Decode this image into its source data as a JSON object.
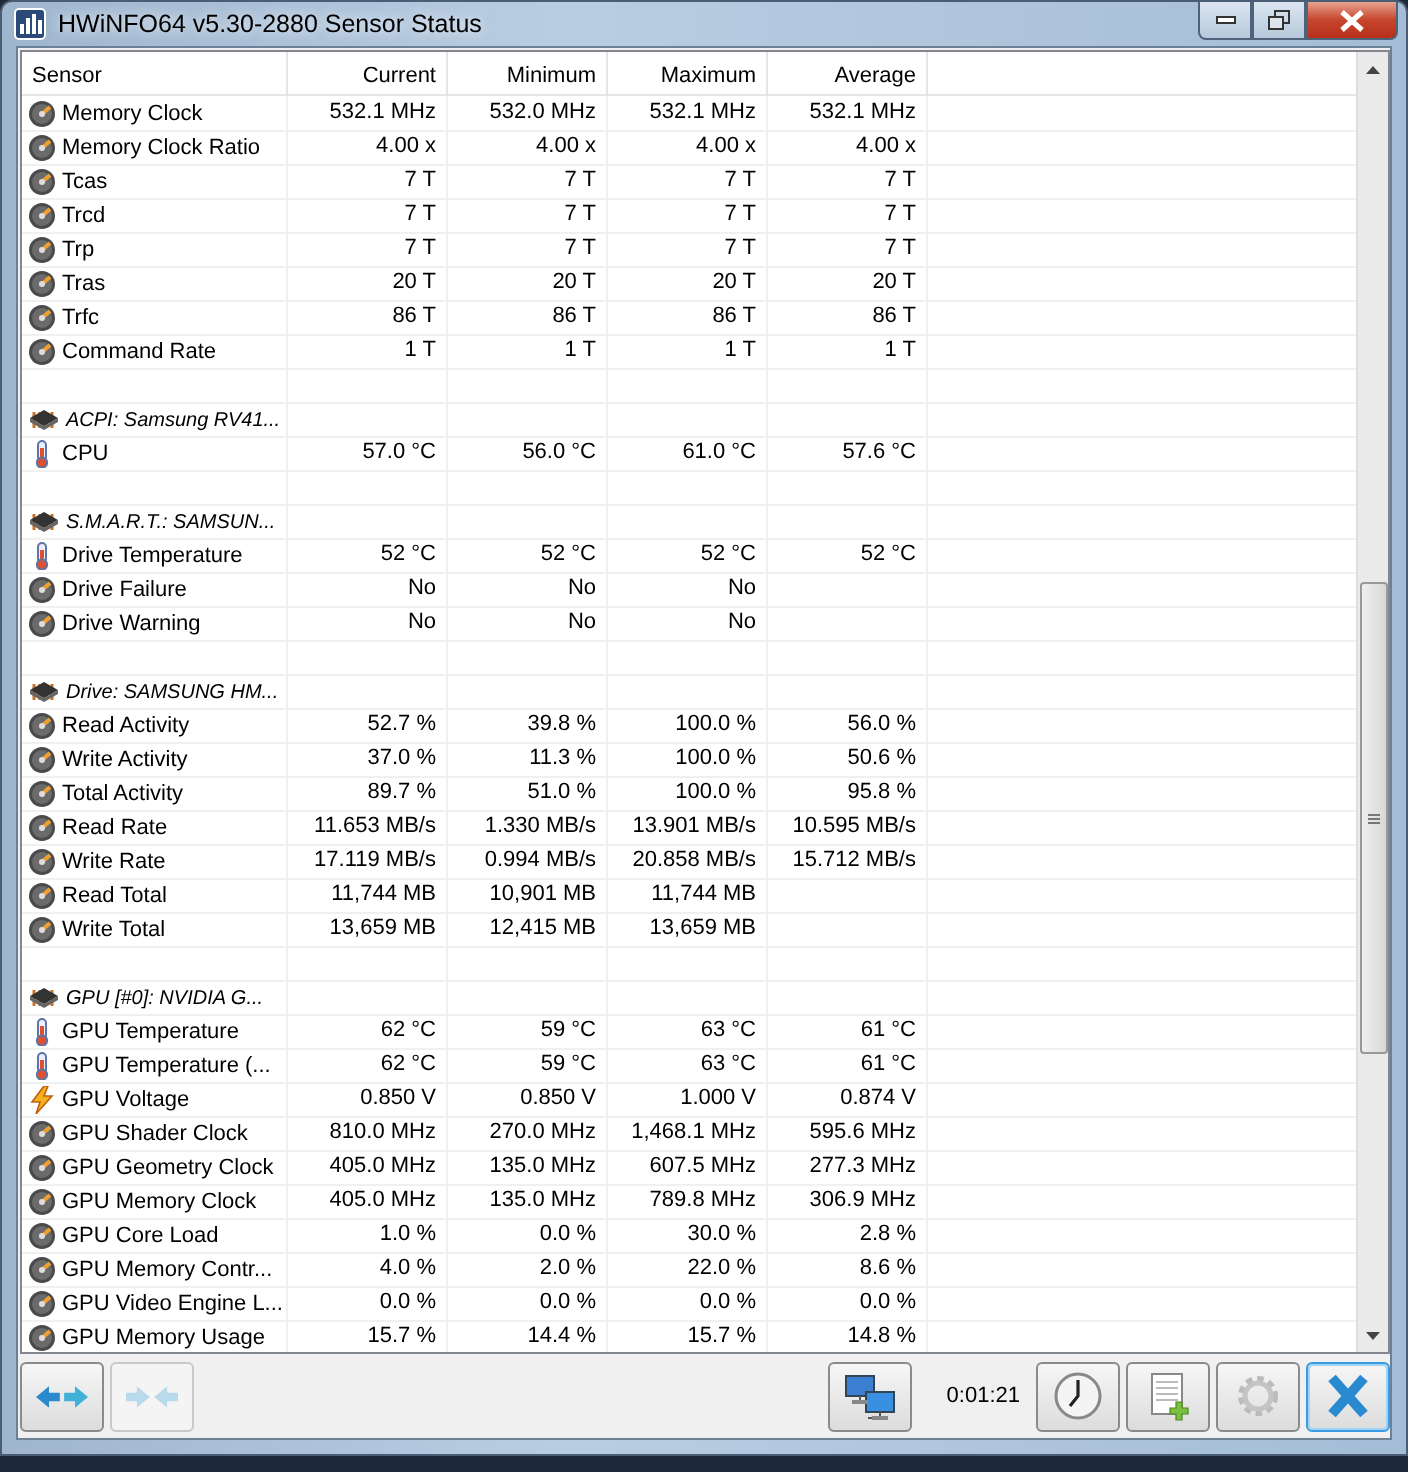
{
  "window": {
    "title": "HWiNFO64 v5.30-2880 Sensor Status"
  },
  "table": {
    "columns": [
      "Sensor",
      "Current",
      "Minimum",
      "Maximum",
      "Average"
    ],
    "rows": [
      {
        "kind": "other",
        "cells": [
          "Memory Clock",
          "532.1 MHz",
          "532.0 MHz",
          "532.1 MHz",
          "532.1 MHz"
        ]
      },
      {
        "kind": "other",
        "cells": [
          "Memory Clock Ratio",
          "4.00 x",
          "4.00 x",
          "4.00 x",
          "4.00 x"
        ]
      },
      {
        "kind": "other",
        "cells": [
          "Tcas",
          "7 T",
          "7 T",
          "7 T",
          "7 T"
        ]
      },
      {
        "kind": "other",
        "cells": [
          "Trcd",
          "7 T",
          "7 T",
          "7 T",
          "7 T"
        ]
      },
      {
        "kind": "other",
        "cells": [
          "Trp",
          "7 T",
          "7 T",
          "7 T",
          "7 T"
        ]
      },
      {
        "kind": "other",
        "cells": [
          "Tras",
          "20 T",
          "20 T",
          "20 T",
          "20 T"
        ]
      },
      {
        "kind": "other",
        "cells": [
          "Trfc",
          "86 T",
          "86 T",
          "86 T",
          "86 T"
        ]
      },
      {
        "kind": "other",
        "cells": [
          "Command Rate",
          "1 T",
          "1 T",
          "1 T",
          "1 T"
        ]
      },
      {
        "kind": "blank"
      },
      {
        "kind": "group",
        "label": "ACPI: Samsung RV41..."
      },
      {
        "kind": "temperature",
        "cells": [
          "CPU",
          "57.0 °C",
          "56.0 °C",
          "61.0 °C",
          "57.6 °C"
        ]
      },
      {
        "kind": "blank"
      },
      {
        "kind": "group",
        "label": "S.M.A.R.T.: SAMSUN..."
      },
      {
        "kind": "temperature",
        "cells": [
          "Drive Temperature",
          "52 °C",
          "52 °C",
          "52 °C",
          "52 °C"
        ]
      },
      {
        "kind": "other",
        "cells": [
          "Drive Failure",
          "No",
          "No",
          "No"
        ]
      },
      {
        "kind": "other",
        "cells": [
          "Drive Warning",
          "No",
          "No",
          "No"
        ]
      },
      {
        "kind": "blank"
      },
      {
        "kind": "group",
        "label": "Drive: SAMSUNG HM..."
      },
      {
        "kind": "other",
        "cells": [
          "Read Activity",
          "52.7 %",
          "39.8 %",
          "100.0 %",
          "56.0 %"
        ]
      },
      {
        "kind": "other",
        "cells": [
          "Write Activity",
          "37.0 %",
          "11.3 %",
          "100.0 %",
          "50.6 %"
        ]
      },
      {
        "kind": "other",
        "cells": [
          "Total Activity",
          "89.7 %",
          "51.0 %",
          "100.0 %",
          "95.8 %"
        ]
      },
      {
        "kind": "other",
        "cells": [
          "Read Rate",
          "11.653 MB/s",
          "1.330 MB/s",
          "13.901 MB/s",
          "10.595 MB/s"
        ]
      },
      {
        "kind": "other",
        "cells": [
          "Write Rate",
          "17.119 MB/s",
          "0.994 MB/s",
          "20.858 MB/s",
          "15.712 MB/s"
        ]
      },
      {
        "kind": "other",
        "cells": [
          "Read Total",
          "11,744 MB",
          "10,901 MB",
          "11,744 MB"
        ]
      },
      {
        "kind": "other",
        "cells": [
          "Write Total",
          "13,659 MB",
          "12,415 MB",
          "13,659 MB"
        ]
      },
      {
        "kind": "blank"
      },
      {
        "kind": "group",
        "label": "GPU [#0]: NVIDIA G..."
      },
      {
        "kind": "temperature",
        "cells": [
          "GPU Temperature",
          "62 °C",
          "59 °C",
          "63 °C",
          "61 °C"
        ]
      },
      {
        "kind": "temperature",
        "cells": [
          "GPU Temperature (...",
          "62 °C",
          "59 °C",
          "63 °C",
          "61 °C"
        ]
      },
      {
        "kind": "voltage",
        "cells": [
          "GPU Voltage",
          "0.850 V",
          "0.850 V",
          "1.000 V",
          "0.874 V"
        ]
      },
      {
        "kind": "other",
        "cells": [
          "GPU Shader Clock",
          "810.0 MHz",
          "270.0 MHz",
          "1,468.1 MHz",
          "595.6 MHz"
        ]
      },
      {
        "kind": "other",
        "cells": [
          "GPU Geometry Clock",
          "405.0 MHz",
          "135.0 MHz",
          "607.5 MHz",
          "277.3 MHz"
        ]
      },
      {
        "kind": "other",
        "cells": [
          "GPU Memory Clock",
          "405.0 MHz",
          "135.0 MHz",
          "789.8 MHz",
          "306.9 MHz"
        ]
      },
      {
        "kind": "other",
        "cells": [
          "GPU Core Load",
          "1.0 %",
          "0.0 %",
          "30.0 %",
          "2.8 %"
        ]
      },
      {
        "kind": "other",
        "cells": [
          "GPU Memory Contr...",
          "4.0 %",
          "2.0 %",
          "22.0 %",
          "8.6 %"
        ]
      },
      {
        "kind": "other",
        "cells": [
          "GPU Video Engine L...",
          "0.0 %",
          "0.0 %",
          "0.0 %",
          "0.0 %"
        ]
      },
      {
        "kind": "other",
        "cells": [
          "GPU Memory Usage",
          "15.7 %",
          "14.4 %",
          "15.7 %",
          "14.8 %"
        ]
      }
    ]
  },
  "toolbar": {
    "elapsed": "0:01:21",
    "buttons": [
      {
        "disabled": false,
        "focused": false
      },
      {
        "disabled": true,
        "focused": false
      },
      {
        "disabled": false,
        "focused": false
      },
      {
        "disabled": false,
        "focused": false
      },
      {
        "disabled": false,
        "focused": false
      },
      {
        "disabled": false,
        "focused": false
      },
      {
        "disabled": false,
        "focused": true
      }
    ]
  }
}
